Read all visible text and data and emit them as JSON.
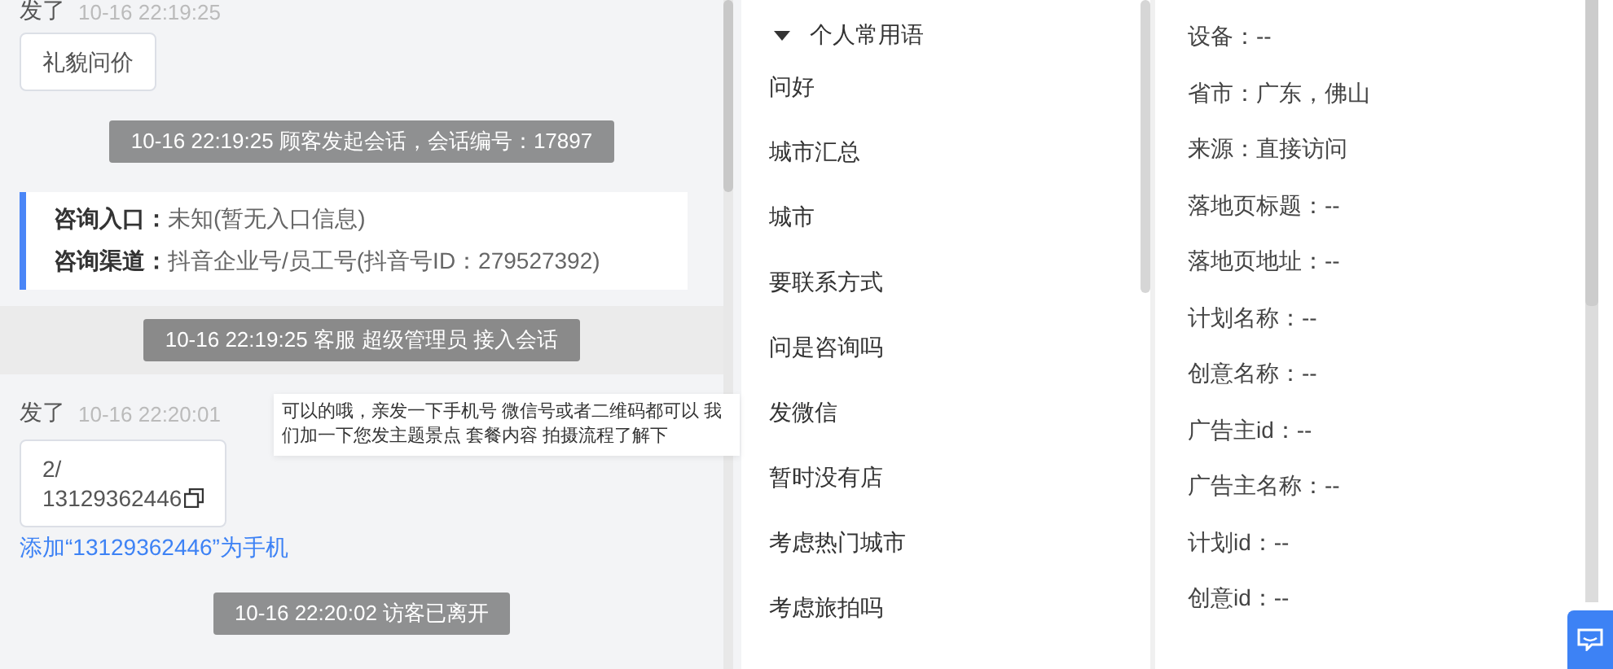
{
  "chat": {
    "messages": [
      {
        "kind": "sent",
        "sender": "发了",
        "time": "10-16 22:19:25",
        "lines": [
          "礼貌问价"
        ],
        "copyable": false
      },
      {
        "kind": "system",
        "text": "10-16 22:19:25 顾客发起会话，会话编号：17897",
        "highlighted": false
      },
      {
        "kind": "info",
        "rows": [
          {
            "label": "咨询入口：",
            "value": "未知(暂无入口信息)"
          },
          {
            "label": "咨询渠道：",
            "value": "抖音企业号/员工号(抖音号ID：279527392)"
          }
        ]
      },
      {
        "kind": "system",
        "text": "10-16 22:19:25 客服 超级管理员 接入会话",
        "highlighted": true
      },
      {
        "kind": "sent",
        "sender": "发了",
        "time": "10-16 22:20:01",
        "lines": [
          "2/",
          "13129362446"
        ],
        "copyable": true,
        "link": "添加“13129362446”为手机"
      },
      {
        "kind": "system",
        "text": "10-16 22:20:02 访客已离开",
        "highlighted": false
      }
    ]
  },
  "tooltip": {
    "text": "可以的哦，亲发一下手机号 微信号或者二维码都可以 我们加一下您发主题景点 套餐内容 拍摄流程了解下"
  },
  "phrases": {
    "group": "个人常用语",
    "expanded": true,
    "items": [
      "问好",
      "城市汇总",
      "城市",
      "要联系方式",
      "问是咨询吗",
      "发微信",
      "暂时没有店",
      "考虑热门城市",
      "考虑旅拍吗"
    ]
  },
  "visitor_info": [
    "设备：--",
    "省市：广东，佛山",
    "来源：直接访问",
    "落地页标题：--",
    "落地页地址：--",
    "计划名称：--",
    "创意名称：--",
    "广告主id：--",
    "广告主名称：--",
    "计划id：--",
    "创意id：--"
  ]
}
